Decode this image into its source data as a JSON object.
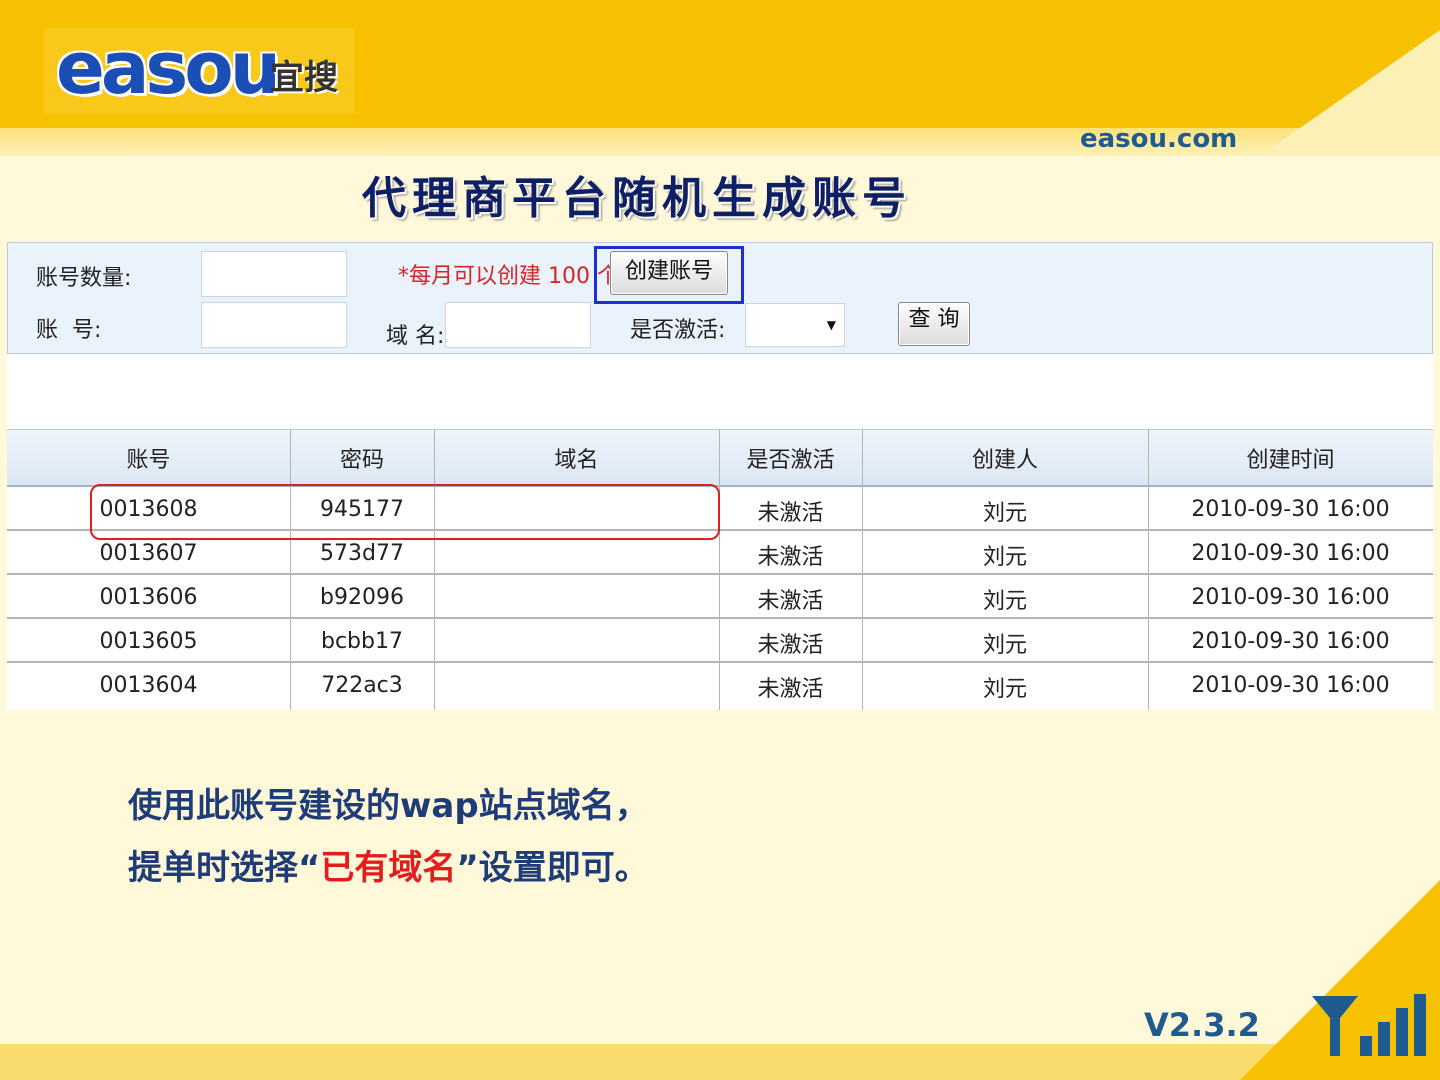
{
  "header": {
    "logo_text": "easou",
    "logo_cn": "宜搜",
    "site_url": "easou.com",
    "page_title": "代理商平台随机生成账号",
    "version": "V2.3.2"
  },
  "form": {
    "count_label": "账号数量:",
    "account_label": "账  号:",
    "domain_label": "域 名:",
    "activated_label": "是否激活:",
    "monthly_note": "*每月可以创建 100 个",
    "create_button": "创建账号",
    "query_button": "查 询",
    "activated_selected": ""
  },
  "table": {
    "columns": [
      "账号",
      "密码",
      "域名",
      "是否激活",
      "创建人",
      "创建时间"
    ],
    "rows": [
      [
        "0013608",
        "945177",
        "",
        "未激活",
        "刘元",
        "2010-09-30 16:00"
      ],
      [
        "0013607",
        "573d77",
        "",
        "未激活",
        "刘元",
        "2010-09-30 16:00"
      ],
      [
        "0013606",
        "b92096",
        "",
        "未激活",
        "刘元",
        "2010-09-30 16:00"
      ],
      [
        "0013605",
        "bcbb17",
        "",
        "未激活",
        "刘元",
        "2010-09-30 16:00"
      ],
      [
        "0013604",
        "722ac3",
        "",
        "未激活",
        "刘元",
        "2010-09-30 16:00"
      ]
    ]
  },
  "caption": {
    "line1": "使用此账号建设的wap站点域名，",
    "line2_before": "提单时选择“",
    "line2_highlight": "已有域名",
    "line2_after": "”设置即可。"
  },
  "colors": {
    "brand_yellow": "#f6c100",
    "title_navy": "#0f1f66",
    "highlight_red": "#e31d1d",
    "highlight_blue": "#1c2fd0"
  },
  "icons": [
    "signal-icon"
  ]
}
